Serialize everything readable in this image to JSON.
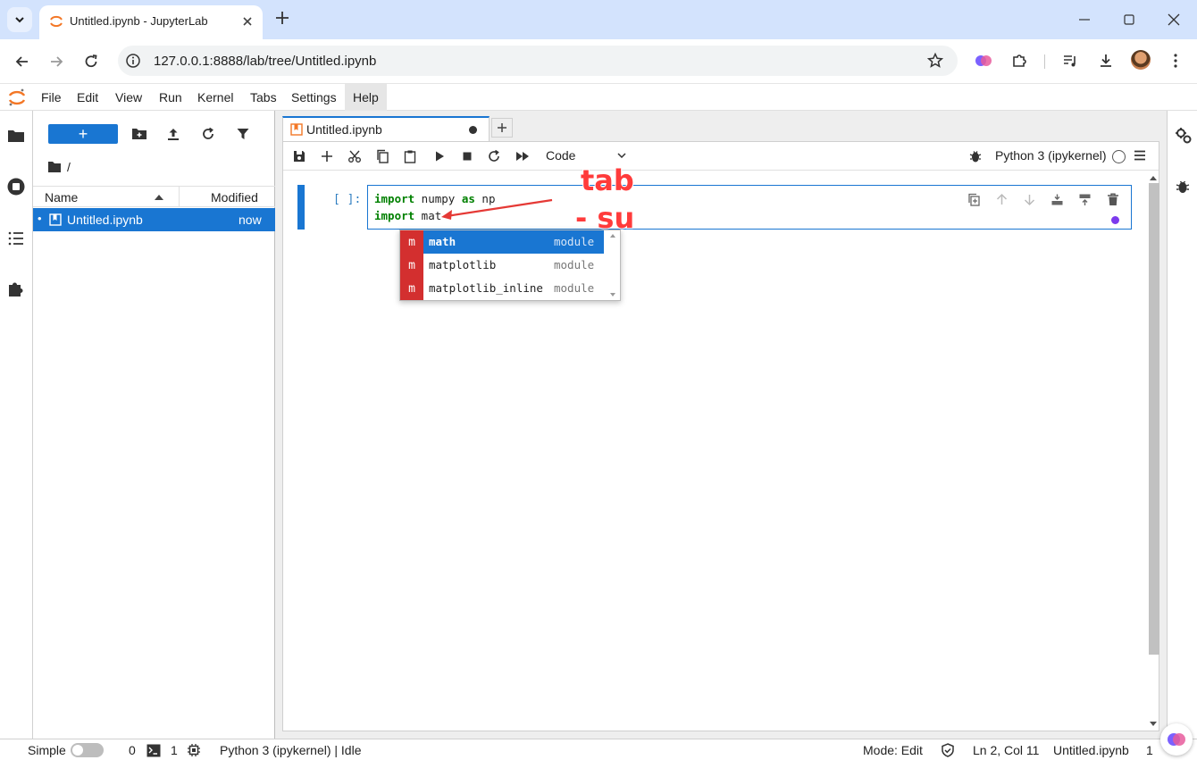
{
  "browser": {
    "tab_title": "Untitled.ipynb - JupyterLab",
    "url": "127.0.0.1:8888/lab/tree/Untitled.ipynb"
  },
  "menubar": {
    "items": [
      "File",
      "Edit",
      "View",
      "Run",
      "Kernel",
      "Tabs",
      "Settings",
      "Help"
    ]
  },
  "filebrowser": {
    "new_button": "+",
    "breadcrumb": "/",
    "columns": {
      "name": "Name",
      "modified": "Modified"
    },
    "files": [
      {
        "name": "Untitled.ipynb",
        "modified": "now",
        "selected": true
      }
    ]
  },
  "notebook": {
    "tab_title": "Untitled.ipynb",
    "cell_type": "Code",
    "kernel_name": "Python 3 (ipykernel)",
    "cell": {
      "prompt": "[ ]:",
      "lines": [
        {
          "kw": "import",
          "rest_a": " numpy ",
          "kw2": "as",
          "rest_b": " np"
        },
        {
          "kw": "import",
          "rest_a": " mat",
          "kw2": "",
          "rest_b": ""
        }
      ]
    },
    "completer": {
      "items": [
        {
          "badge": "m",
          "label": "math",
          "type": "module",
          "active": true
        },
        {
          "badge": "m",
          "label": "matplotlib",
          "type": "module",
          "active": false
        },
        {
          "badge": "m",
          "label": "matplotlib_inline",
          "type": "module",
          "active": false
        }
      ]
    }
  },
  "annotations": {
    "line1": "tab",
    "line2": "- su"
  },
  "statusbar": {
    "simple_label": "Simple",
    "terminals_count": "0",
    "kernels_count": "1",
    "kernel_status": "Python 3 (ipykernel) | Idle",
    "mode": "Mode: Edit",
    "cursor": "Ln 2, Col 11",
    "file": "Untitled.ipynb",
    "notifications": "1"
  },
  "colors": {
    "accent": "#1976d2",
    "completer_badge": "#d32f2f",
    "annotation": "#ff3b3b",
    "keyword": "#008000"
  }
}
